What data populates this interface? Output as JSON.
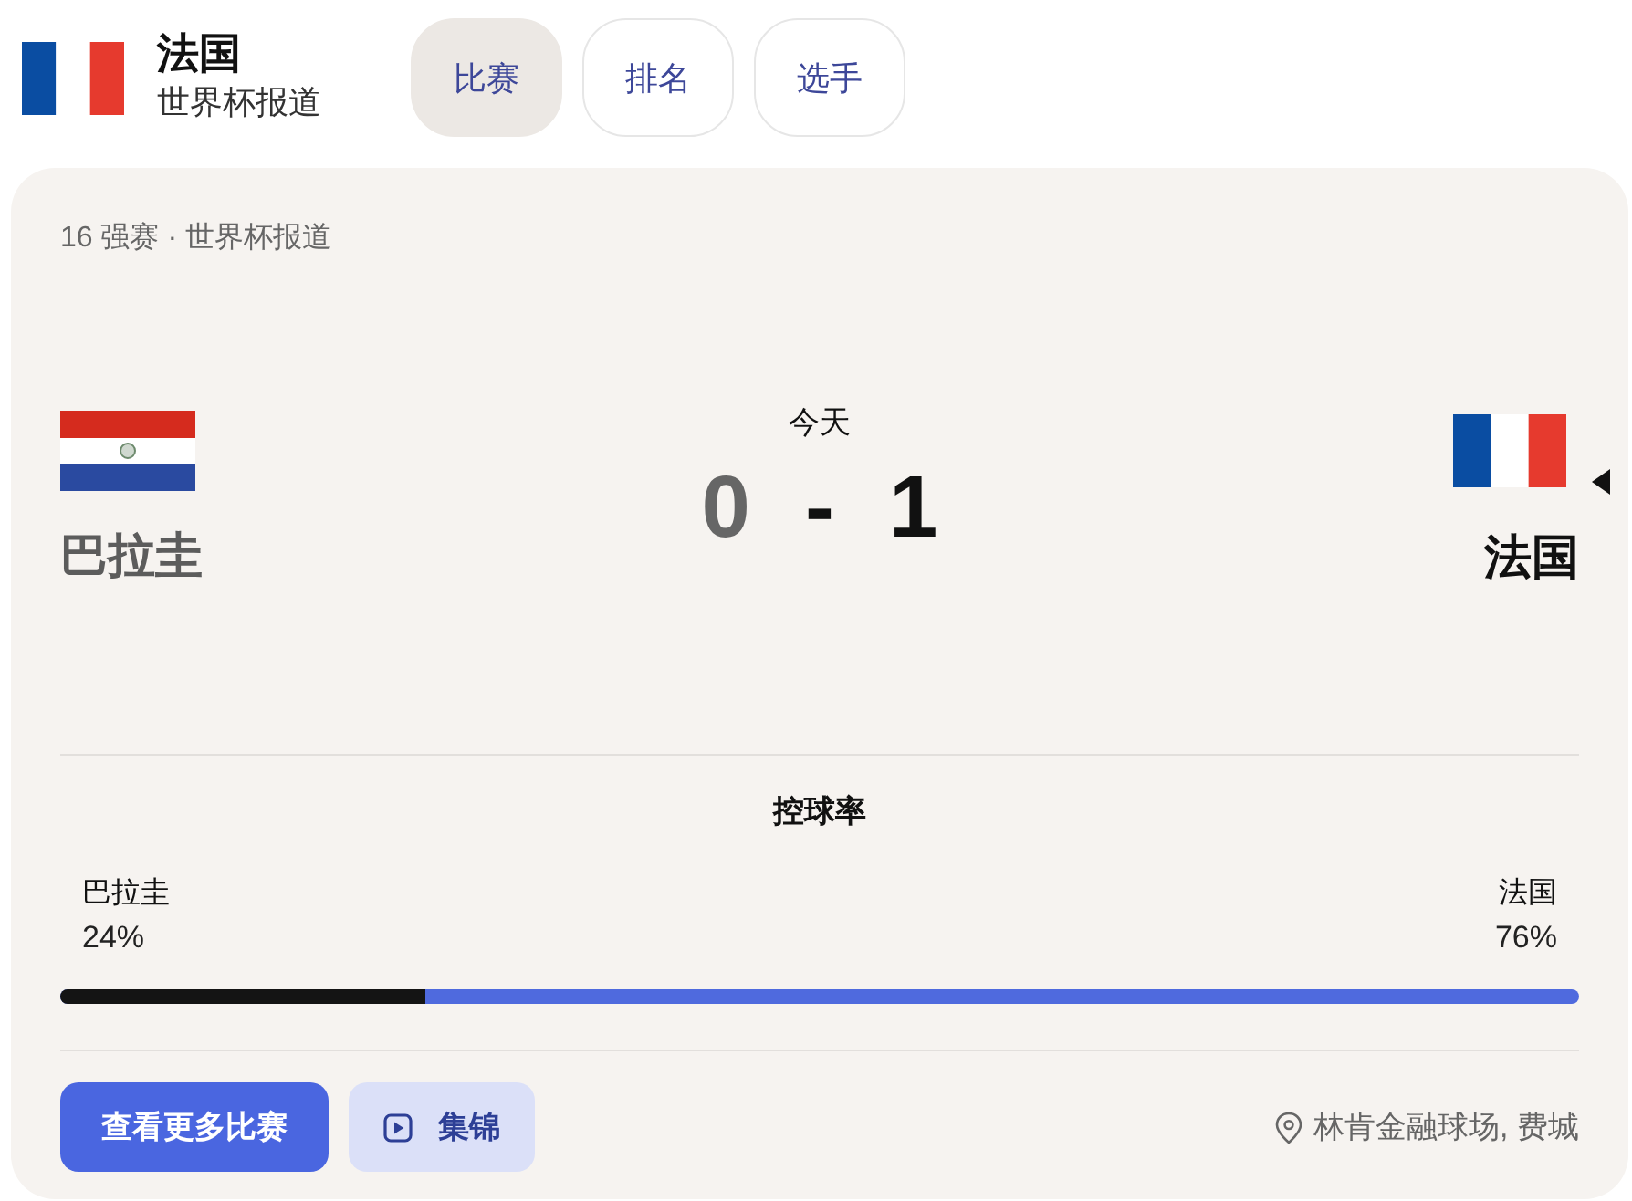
{
  "header": {
    "title": "法国",
    "subtitle": "世界杯报道"
  },
  "tabs": [
    {
      "label": "比赛",
      "selected": true
    },
    {
      "label": "排名",
      "selected": false
    },
    {
      "label": "选手",
      "selected": false
    }
  ],
  "match": {
    "stage": "16 强赛 · 世界杯报道",
    "date": "今天",
    "separator": "-",
    "teams": [
      {
        "name": "巴拉圭",
        "score": "0",
        "winner": false
      },
      {
        "name": "法国",
        "score": "1",
        "winner": true
      }
    ]
  },
  "possession": {
    "title": "控球率",
    "level": 0.24,
    "teams": [
      {
        "name": "巴拉圭",
        "reading": "24%"
      },
      {
        "name": "法国",
        "reading": "76%"
      }
    ]
  },
  "actions": [
    {
      "kind": "primary",
      "label": "查看更多比赛"
    },
    {
      "kind": "video",
      "label": "集锦"
    }
  ],
  "venue": "林肯金融球场, 费城"
}
